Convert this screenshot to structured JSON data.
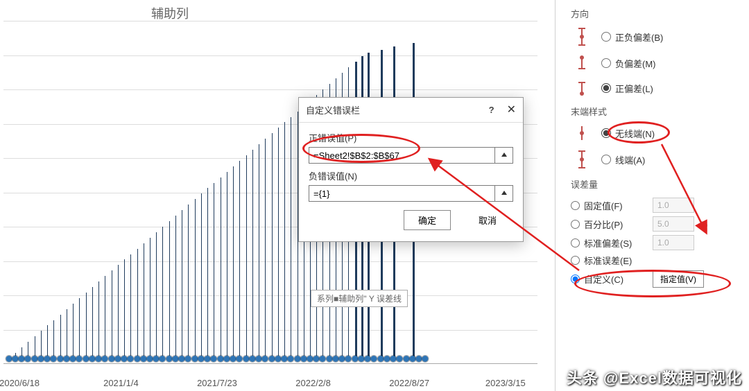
{
  "chart": {
    "title": "辅助列",
    "x_labels": [
      "2020/6/18",
      "2021/1/4",
      "2021/7/23",
      "2022/2/8",
      "2022/8/27",
      "2023/3/15"
    ],
    "tooltip": "系列■辅助列\" Y 误差线"
  },
  "dialog": {
    "title": "自定义错误栏",
    "help": "?",
    "close": "✕",
    "pos_label": "正错误值(P)",
    "pos_value": "=Sheet2!$B$2:$B$67",
    "neg_label": "负错误值(N)",
    "neg_value": "={1}",
    "ok": "确定",
    "cancel": "取消"
  },
  "side": {
    "direction_label": "方向",
    "dir_both": "正负偏差(B)",
    "dir_minus": "负偏差(M)",
    "dir_plus": "正偏差(L)",
    "endstyle_label": "末端样式",
    "end_nocap": "无线端(N)",
    "end_cap": "线端(A)",
    "amount_label": "误差量",
    "amt_fixed": "固定值(F)",
    "amt_fixed_val": "1.0",
    "amt_percent": "百分比(P)",
    "amt_percent_val": "5.0",
    "amt_percent_unit": "%",
    "amt_stdev": "标准偏差(S)",
    "amt_stdev_val": "1.0",
    "amt_sterr": "标准误差(E)",
    "amt_custom": "自定义(C)",
    "specify": "指定值(V)"
  },
  "watermark": "头条 @Excel数据可视化",
  "chart_data": {
    "type": "bar",
    "title": "辅助列",
    "xlabel": "",
    "ylabel": "",
    "categories_range": "2020/6/18 … 2023/3/15",
    "n_points": 66,
    "values_shape": "roughly linear increase from ~0 to ~450 across first ~56 points then flat base markers",
    "series": [
      {
        "name": "辅助列",
        "values_note": "error-bar heights ramp 0→~450, source =Sheet2!$B$2:$B$67"
      }
    ]
  }
}
